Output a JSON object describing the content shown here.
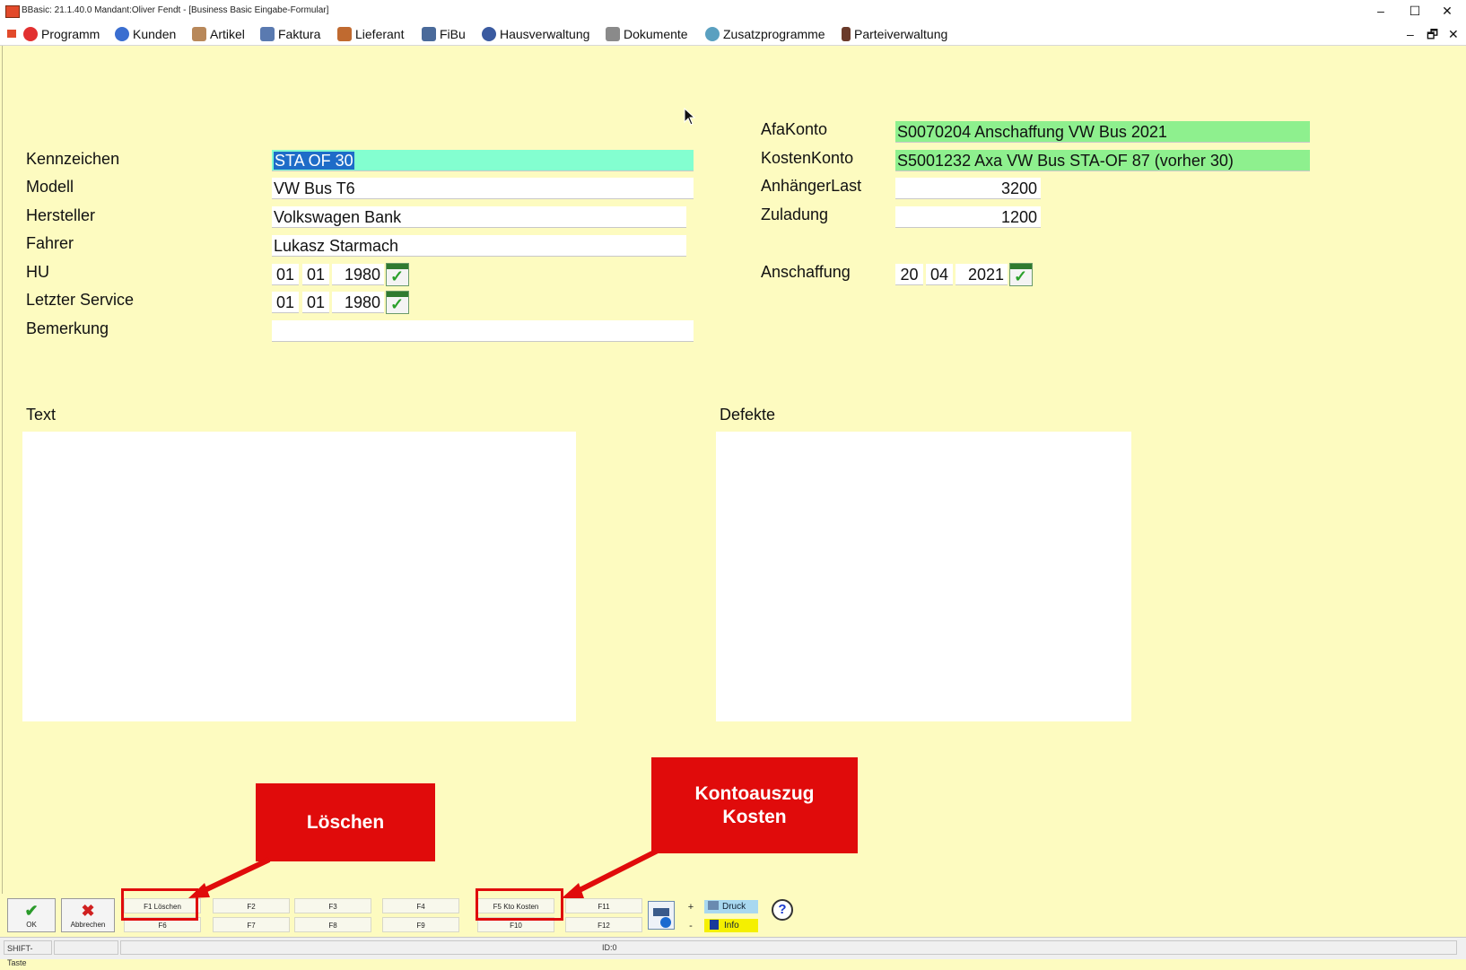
{
  "window": {
    "title": "BBasic: 21.1.40.0 Mandant:Oliver Fendt  - [Business Basic Eingabe-Formular]",
    "minimize": "–",
    "maximize": "☐",
    "close": "✕"
  },
  "menu": {
    "items": [
      "Programm",
      "Kunden",
      "Artikel",
      "Faktura",
      "Lieferant",
      "FiBu",
      "Hausverwaltung",
      "Dokumente",
      "Zusatzprogramme",
      "Parteiverwaltung"
    ],
    "mdi_minimize": "–",
    "mdi_restore": "🗗",
    "mdi_close": "✕"
  },
  "form": {
    "kennzeichen_label": "Kennzeichen",
    "kennzeichen_value": "STA OF 30",
    "modell_label": "Modell",
    "modell_value": "VW Bus T6",
    "hersteller_label": "Hersteller",
    "hersteller_value": "Volkswagen Bank",
    "fahrer_label": "Fahrer",
    "fahrer_value": "Lukasz Starmach",
    "hu_label": "HU",
    "hu_day": "01",
    "hu_month": "01",
    "hu_year": "1980",
    "service_label": "Letzter Service",
    "service_day": "01",
    "service_month": "01",
    "service_year": "1980",
    "bemerkung_label": "Bemerkung",
    "bemerkung_value": "",
    "afakonto_label": "AfaKonto",
    "afakonto_value": "S0070204 Anschaffung VW Bus 2021",
    "kostenkonto_label": "KostenKonto",
    "kostenkonto_value": "S5001232 Axa VW Bus STA-OF 87 (vorher 30)",
    "anhaengerlast_label": "AnhängerLast",
    "anhaengerlast_value": "3200",
    "zuladung_label": "Zuladung",
    "zuladung_value": "1200",
    "anschaffung_label": "Anschaffung",
    "anschaffung_day": "20",
    "anschaffung_month": "04",
    "anschaffung_year": "2021",
    "text_label": "Text",
    "defekte_label": "Defekte"
  },
  "callouts": {
    "loeschen": "Löschen",
    "kontoauszug_line1": "Kontoauszug",
    "kontoauszug_line2": "Kosten"
  },
  "toolbar": {
    "ok": "OK",
    "abbrechen": "Abbrechen",
    "fkeys_top": [
      "F1 Löschen",
      "F2",
      "F3",
      "F4",
      "F5 Kto Kosten",
      "F11"
    ],
    "fkeys_bottom": [
      "F6",
      "F7",
      "F8",
      "F9",
      "F10",
      "F12"
    ],
    "plus": "+",
    "minus": "-",
    "druck": "Druck",
    "info": "Info",
    "help": "?"
  },
  "statusbar": {
    "shift": "SHIFT-Taste",
    "id": "ID:0"
  },
  "colors": {
    "background": "#fdfbc0",
    "callout": "#e00b0b",
    "green_field": "#8ef08e",
    "cyan_field": "#83ffd0"
  }
}
